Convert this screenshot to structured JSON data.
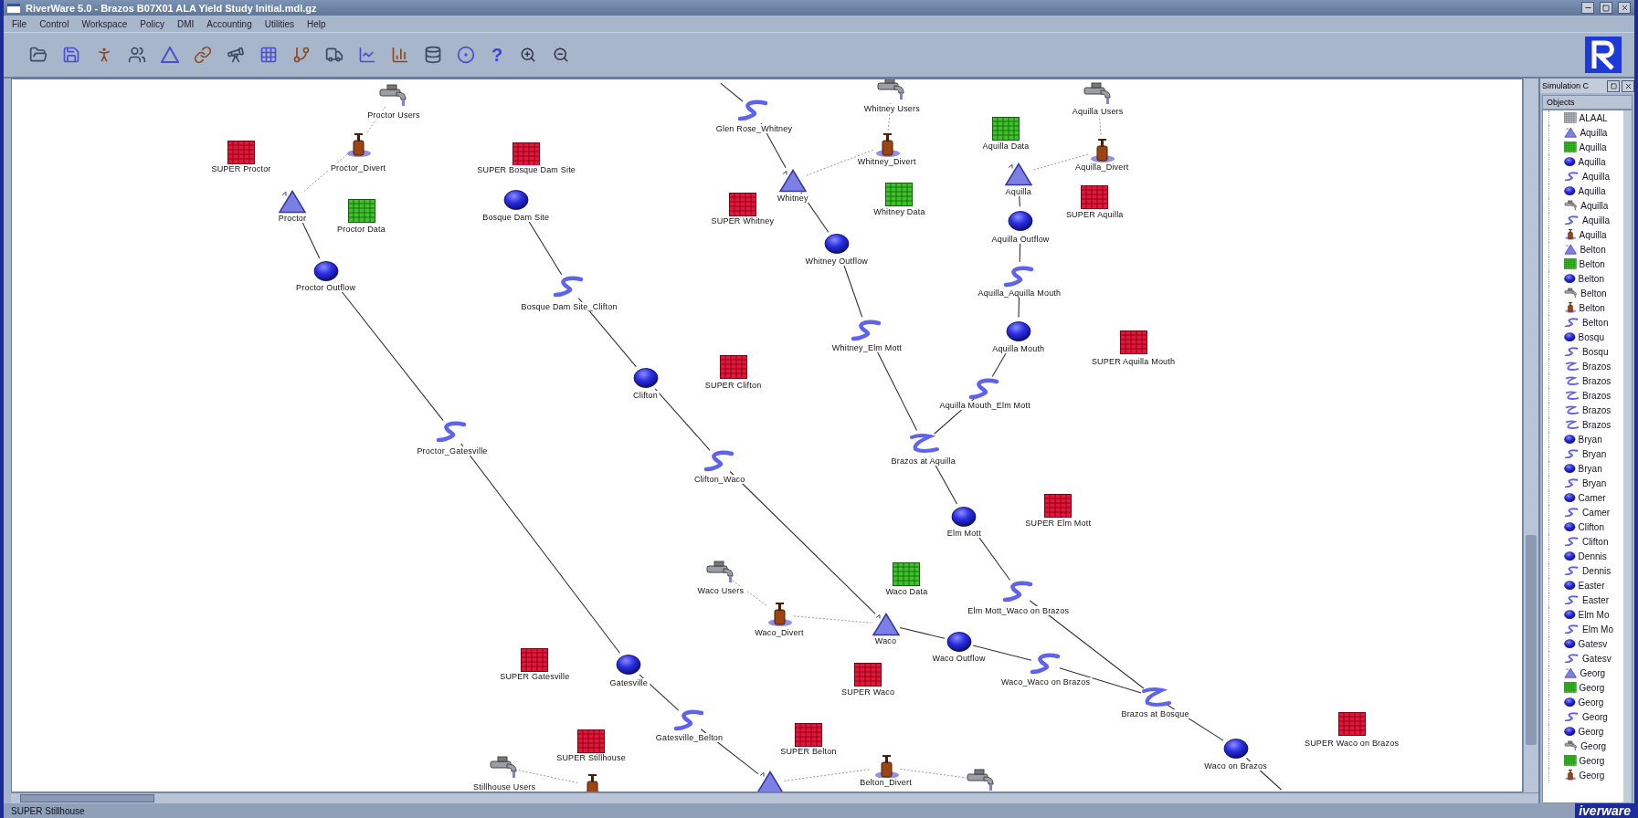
{
  "window": {
    "title": "RiverWare 5.0 - Brazos B07X01 ALA Yield Study Initial.mdl.gz"
  },
  "menu": [
    "File",
    "Control",
    "Workspace",
    "Policy",
    "DMI",
    "Accounting",
    "Utilities",
    "Help"
  ],
  "toolbar": {
    "help": "?"
  },
  "workspace": {
    "nodes": [
      {
        "kind": "user",
        "label": "Proctor Users"
      },
      {
        "kind": "super",
        "label": "SUPER Proctor"
      },
      {
        "kind": "divert",
        "label": "Proctor_Divert"
      },
      {
        "kind": "super",
        "label": "SUPER Bosque Dam Site"
      },
      {
        "kind": "reservoir",
        "label": "Proctor"
      },
      {
        "kind": "data",
        "label": "Proctor Data"
      },
      {
        "kind": "gauge",
        "label": "Bosque Dam Site"
      },
      {
        "kind": "gauge",
        "label": "Proctor Outflow"
      },
      {
        "kind": "reach",
        "label": "Bosque Dam Site_Clifton"
      },
      {
        "kind": "gauge",
        "label": "Clifton"
      },
      {
        "kind": "super",
        "label": "SUPER Clifton"
      },
      {
        "kind": "reach",
        "label": "Proctor_Gatesville"
      },
      {
        "kind": "reach",
        "label": "Clifton_Waco"
      },
      {
        "kind": "reach",
        "label": "Glen Rose_Whitney"
      },
      {
        "kind": "user",
        "label": "Whitney Users"
      },
      {
        "kind": "divert",
        "label": "Whitney_Divert"
      },
      {
        "kind": "reservoir",
        "label": "Whitney"
      },
      {
        "kind": "super",
        "label": "SUPER Whitney"
      },
      {
        "kind": "data",
        "label": "Whitney Data"
      },
      {
        "kind": "gauge",
        "label": "Whitney Outflow"
      },
      {
        "kind": "reach",
        "label": "Whitney_Elm Mott"
      },
      {
        "kind": "data",
        "label": "Aquilla Data"
      },
      {
        "kind": "user",
        "label": "Aquilla Users"
      },
      {
        "kind": "divert",
        "label": "Aquilla_Divert"
      },
      {
        "kind": "reservoir",
        "label": "Aquilla"
      },
      {
        "kind": "super",
        "label": "SUPER Aquilla"
      },
      {
        "kind": "gauge",
        "label": "Aquilla Outflow"
      },
      {
        "kind": "reach",
        "label": "Aquilla_Aquilla Mouth"
      },
      {
        "kind": "gauge",
        "label": "Aquilla Mouth"
      },
      {
        "kind": "super",
        "label": "SUPER Aquilla Mouth"
      },
      {
        "kind": "reach",
        "label": "Aquilla Mouth_Elm Mott"
      },
      {
        "kind": "confluence",
        "label": "Brazos at Aquilla"
      },
      {
        "kind": "gauge",
        "label": "Elm Mott"
      },
      {
        "kind": "super",
        "label": "SUPER Elm Mott"
      },
      {
        "kind": "reach",
        "label": "Elm Mott_Waco on Brazos"
      },
      {
        "kind": "user",
        "label": "Waco Users"
      },
      {
        "kind": "divert",
        "label": "Waco_Divert"
      },
      {
        "kind": "data",
        "label": "Waco Data"
      },
      {
        "kind": "reservoir",
        "label": "Waco"
      },
      {
        "kind": "gauge",
        "label": "Waco Outflow"
      },
      {
        "kind": "reach",
        "label": "Waco_Waco on Brazos"
      },
      {
        "kind": "confluence",
        "label": "Brazos at Bosque"
      },
      {
        "kind": "gauge",
        "label": "Waco on Brazos"
      },
      {
        "kind": "super",
        "label": "SUPER Waco on Brazos"
      },
      {
        "kind": "super",
        "label": "SUPER Waco"
      },
      {
        "kind": "super",
        "label": "SUPER Gatesville"
      },
      {
        "kind": "gauge",
        "label": "Gatesville"
      },
      {
        "kind": "reach",
        "label": "Gatesville_Belton"
      },
      {
        "kind": "super",
        "label": "SUPER Stillhouse"
      },
      {
        "kind": "super",
        "label": "SUPER Belton"
      },
      {
        "kind": "user",
        "label": "Stillhouse Users"
      },
      {
        "kind": "divert"
      },
      {
        "kind": "reservoir"
      },
      {
        "kind": "divert",
        "label": "Belton_Divert"
      },
      {
        "kind": "user"
      }
    ]
  },
  "panel": {
    "title": "Simulation C",
    "header": "Objects",
    "items": [
      {
        "kind": "table",
        "label": "ALAAL"
      },
      {
        "kind": "reservoir",
        "label": "Aquilla"
      },
      {
        "kind": "data",
        "label": "Aquilla"
      },
      {
        "kind": "gauge",
        "label": "Aquilla"
      },
      {
        "kind": "reach",
        "label": "Aquilla"
      },
      {
        "kind": "gauge",
        "label": "Aquilla"
      },
      {
        "kind": "user",
        "label": "Aquilla"
      },
      {
        "kind": "reach",
        "label": "Aquilla"
      },
      {
        "kind": "divert",
        "label": "Aquilla"
      },
      {
        "kind": "reservoir",
        "label": "Belton"
      },
      {
        "kind": "data",
        "label": "Belton"
      },
      {
        "kind": "gauge",
        "label": "Belton"
      },
      {
        "kind": "user",
        "label": "Belton"
      },
      {
        "kind": "divert",
        "label": "Belton"
      },
      {
        "kind": "reach",
        "label": "Belton"
      },
      {
        "kind": "gauge",
        "label": "Bosqu"
      },
      {
        "kind": "reach",
        "label": "Bosqu"
      },
      {
        "kind": "confluence",
        "label": "Brazos"
      },
      {
        "kind": "confluence",
        "label": "Brazos"
      },
      {
        "kind": "confluence",
        "label": "Brazos"
      },
      {
        "kind": "confluence",
        "label": "Brazos"
      },
      {
        "kind": "confluence",
        "label": "Brazos"
      },
      {
        "kind": "gauge",
        "label": "Bryan"
      },
      {
        "kind": "reach",
        "label": "Bryan"
      },
      {
        "kind": "gauge",
        "label": "Bryan"
      },
      {
        "kind": "reach",
        "label": "Bryan"
      },
      {
        "kind": "gauge",
        "label": "Camer"
      },
      {
        "kind": "reach",
        "label": "Camer"
      },
      {
        "kind": "gauge",
        "label": "Clifton"
      },
      {
        "kind": "reach",
        "label": "Clifton"
      },
      {
        "kind": "gauge",
        "label": "Dennis"
      },
      {
        "kind": "reach",
        "label": "Dennis"
      },
      {
        "kind": "gauge",
        "label": "Easter"
      },
      {
        "kind": "reach",
        "label": "Easter"
      },
      {
        "kind": "gauge",
        "label": "Elm Mo"
      },
      {
        "kind": "reach",
        "label": "Elm Mo"
      },
      {
        "kind": "gauge",
        "label": "Gatesv"
      },
      {
        "kind": "reach",
        "label": "Gatesv"
      },
      {
        "kind": "reservoir",
        "label": "Georg"
      },
      {
        "kind": "data",
        "label": "Georg"
      },
      {
        "kind": "gauge",
        "label": "Georg"
      },
      {
        "kind": "reach",
        "label": "Georg"
      },
      {
        "kind": "gauge",
        "label": "Georg"
      },
      {
        "kind": "user",
        "label": "Georg"
      },
      {
        "kind": "data",
        "label": "Georg"
      },
      {
        "kind": "divert",
        "label": "Georg"
      }
    ]
  },
  "status_bar": "SUPER Stillhouse",
  "logo": "iverware"
}
